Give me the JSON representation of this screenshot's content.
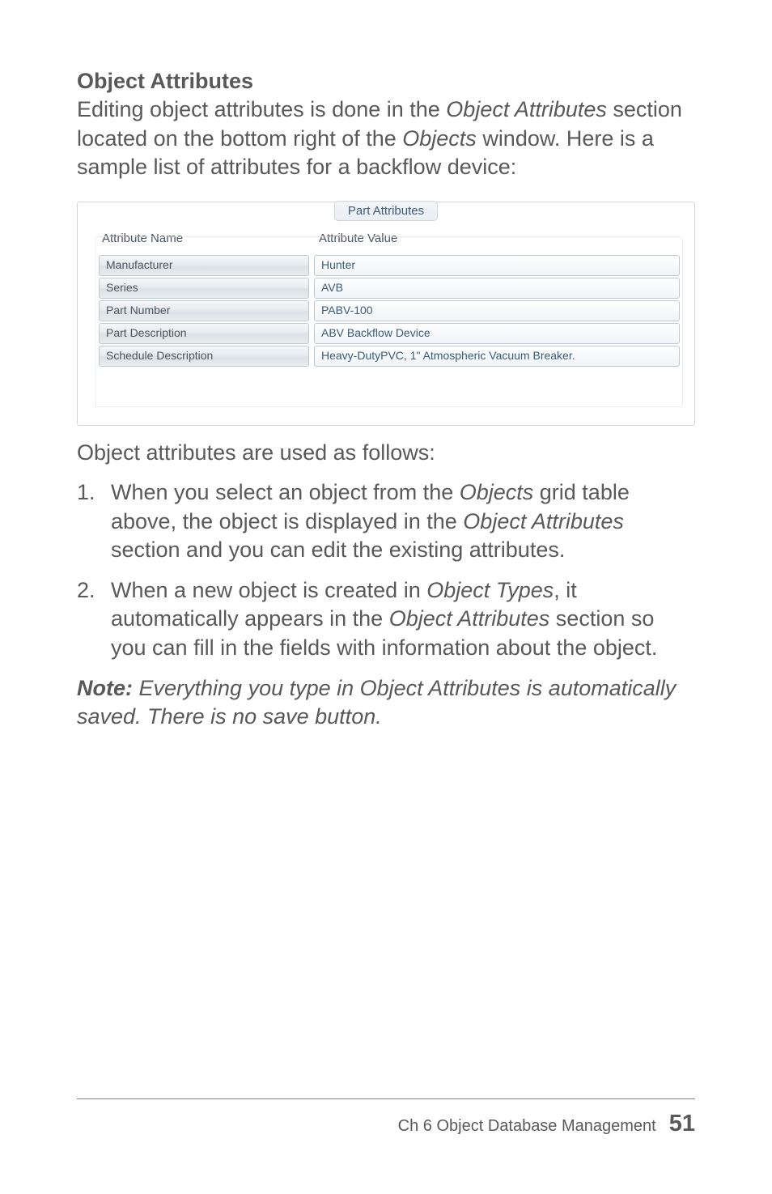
{
  "heading": "Object Attributes",
  "intro_parts": {
    "p1": "Editing object attributes is done in the ",
    "i1": "Object Attributes",
    "p2": " section located on the bottom right of the ",
    "i2": "Objects",
    "p3": " window. Here is a sample list of attributes for a backflow device:"
  },
  "panel": {
    "title": "Part Attributes",
    "header_name": "Attribute Name",
    "header_value": "Attribute Value",
    "rows": [
      {
        "name": "Manufacturer",
        "value": "Hunter"
      },
      {
        "name": "Series",
        "value": "AVB"
      },
      {
        "name": "Part Number",
        "value": "PABV-100"
      },
      {
        "name": "Part Description",
        "value": "ABV Backflow Device"
      },
      {
        "name": "Schedule Description",
        "value": "Heavy-DutyPVC, 1\" Atmospheric Vacuum Breaker."
      }
    ]
  },
  "follow": "Object attributes are used as follows:",
  "items": [
    {
      "num": "1.",
      "p1": "When you select an object from the ",
      "i1": "Objects",
      "p2": " grid table above, the object is displayed in the ",
      "i2": "Object Attributes",
      "p3": " section and you can edit the existing attributes."
    },
    {
      "num": "2.",
      "p1": "When a new object is created in ",
      "i1": "Object Types",
      "p2": ", it automatically appears in the ",
      "i2": "Object Attributes",
      "p3": " section so you can fill in the fields with information about the object."
    }
  ],
  "note": {
    "label": "Note:",
    "text": " Everything you type in Object Attributes is automatically saved. There is no save button."
  },
  "footer": {
    "chapter": "Ch 6   Object Database Management",
    "page": "51"
  }
}
